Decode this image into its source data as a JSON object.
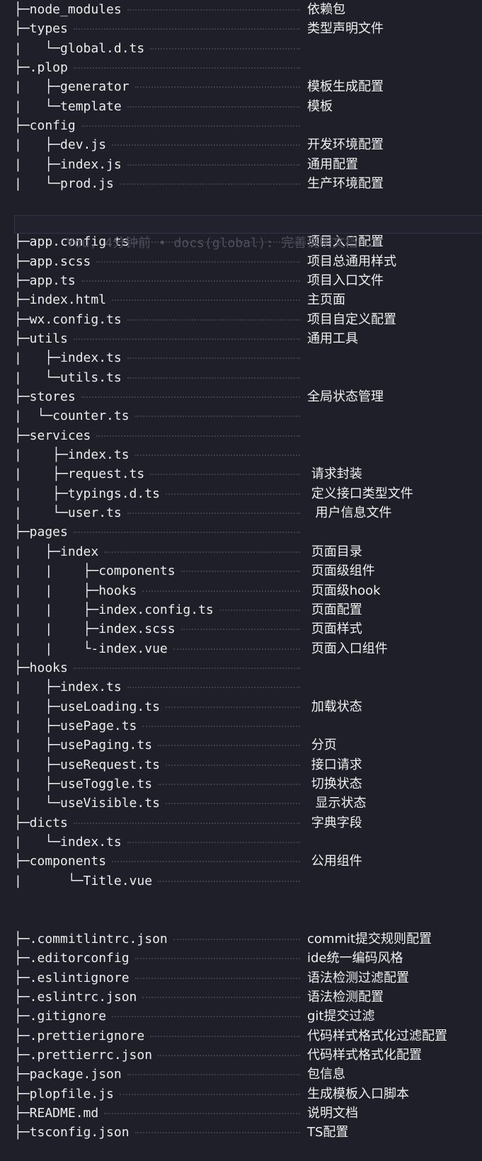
{
  "editor": {
    "lines": [
      {
        "tree": "├─node_modules",
        "comment": "依赖包"
      },
      {
        "tree": "├─types",
        "comment": "类型声明文件"
      },
      {
        "tree": "|   └─global.d.ts",
        "comment": ""
      },
      {
        "tree": "├─.plop",
        "comment": ""
      },
      {
        "tree": "|   ├─generator",
        "comment": "模板生成配置"
      },
      {
        "tree": "|   └─template",
        "comment": "模板"
      },
      {
        "tree": "├─config",
        "comment": ""
      },
      {
        "tree": "|   ├─dev.js",
        "comment": "开发环境配置"
      },
      {
        "tree": "|   ├─index.js",
        "comment": "通用配置"
      },
      {
        "tree": "|   └─prod.js",
        "comment": "生产环境配置"
      },
      {
        "tree": "",
        "comment": ""
      },
      {
        "tree": "",
        "comment": ""
      },
      {
        "tree": "├─app.config.ts",
        "comment": "项目入口配置"
      },
      {
        "tree": "├─app.scss",
        "comment": "项目总通用样式"
      },
      {
        "tree": "├─app.ts",
        "comment": "项目入口文件"
      },
      {
        "tree": "├─index.html",
        "comment": "主页面"
      },
      {
        "tree": "├─wx.config.ts",
        "comment": "项目自定义配置"
      },
      {
        "tree": "├─utils",
        "comment": "通用工具"
      },
      {
        "tree": "|   ├─index.ts",
        "comment": ""
      },
      {
        "tree": "|   └─utils.ts",
        "comment": ""
      },
      {
        "tree": "├─stores",
        "comment": "全局状态管理"
      },
      {
        "tree": "|  └─counter.ts",
        "comment": ""
      },
      {
        "tree": "├─services",
        "comment": ""
      },
      {
        "tree": "|    ├─index.ts",
        "comment": ""
      },
      {
        "tree": "|    ├─request.ts",
        "comment": " 请求封装"
      },
      {
        "tree": "|    ├─typings.d.ts",
        "comment": " 定义接口类型文件"
      },
      {
        "tree": "|    └─user.ts",
        "comment": "  用户信息文件"
      },
      {
        "tree": "├─pages",
        "comment": ""
      },
      {
        "tree": "|   ├─index",
        "comment": " 页面目录"
      },
      {
        "tree": "|   |    ├─components",
        "comment": " 页面级组件"
      },
      {
        "tree": "|   |    ├─hooks",
        "comment": " 页面级hook"
      },
      {
        "tree": "|   |    ├─index.config.ts",
        "comment": " 页面配置"
      },
      {
        "tree": "|   |    ├─index.scss",
        "comment": " 页面样式"
      },
      {
        "tree": "|   |    └-index.vue",
        "comment": " 页面入口组件"
      },
      {
        "tree": "├─hooks",
        "comment": ""
      },
      {
        "tree": "|   ├─index.ts",
        "comment": ""
      },
      {
        "tree": "|   ├─useLoading.ts",
        "comment": " 加载状态"
      },
      {
        "tree": "|   ├─usePage.ts",
        "comment": ""
      },
      {
        "tree": "|   ├─usePaging.ts",
        "comment": " 分页"
      },
      {
        "tree": "|   ├─useRequest.ts",
        "comment": " 接口请求"
      },
      {
        "tree": "|   ├─useToggle.ts",
        "comment": " 切换状态"
      },
      {
        "tree": "|   └─useVisible.ts",
        "comment": "  显示状态"
      },
      {
        "tree": "├─dicts",
        "comment": " 字典字段"
      },
      {
        "tree": "|   └─index.ts",
        "comment": ""
      },
      {
        "tree": "├─components",
        "comment": " 公用组件"
      },
      {
        "tree": "|      └─Title.vue",
        "comment": ""
      },
      {
        "tree": "",
        "comment": ""
      },
      {
        "tree": "",
        "comment": ""
      },
      {
        "tree": "├─.commitlintrc.json",
        "comment": "commit提交规则配置"
      },
      {
        "tree": "├─.editorconfig",
        "comment": "ide统一编码风格"
      },
      {
        "tree": "├─.eslintignore",
        "comment": "语法检测过滤配置"
      },
      {
        "tree": "├─.eslintrc.json",
        "comment": "语法检测配置"
      },
      {
        "tree": "├─.gitignore",
        "comment": "git提交过滤"
      },
      {
        "tree": "├─.prettierignore",
        "comment": "代码样式格式化过滤配置"
      },
      {
        "tree": "├─.prettierrc.json",
        "comment": "代码样式格式化配置"
      },
      {
        "tree": "├─package.json",
        "comment": "包信息"
      },
      {
        "tree": "├─plopfile.js",
        "comment": "生成模板入口脚本"
      },
      {
        "tree": "├─README.md",
        "comment": "说明文档"
      },
      {
        "tree": "├─tsconfig.json",
        "comment": "TS配置"
      }
    ],
    "blame": "You, 4分钟前 • docs(global): 完善说明文档 …"
  },
  "colors": {
    "background": "#1f1f29",
    "text": "#e8e8e8",
    "dots": "#3c3c4a",
    "blame": "#4e4e5e"
  }
}
